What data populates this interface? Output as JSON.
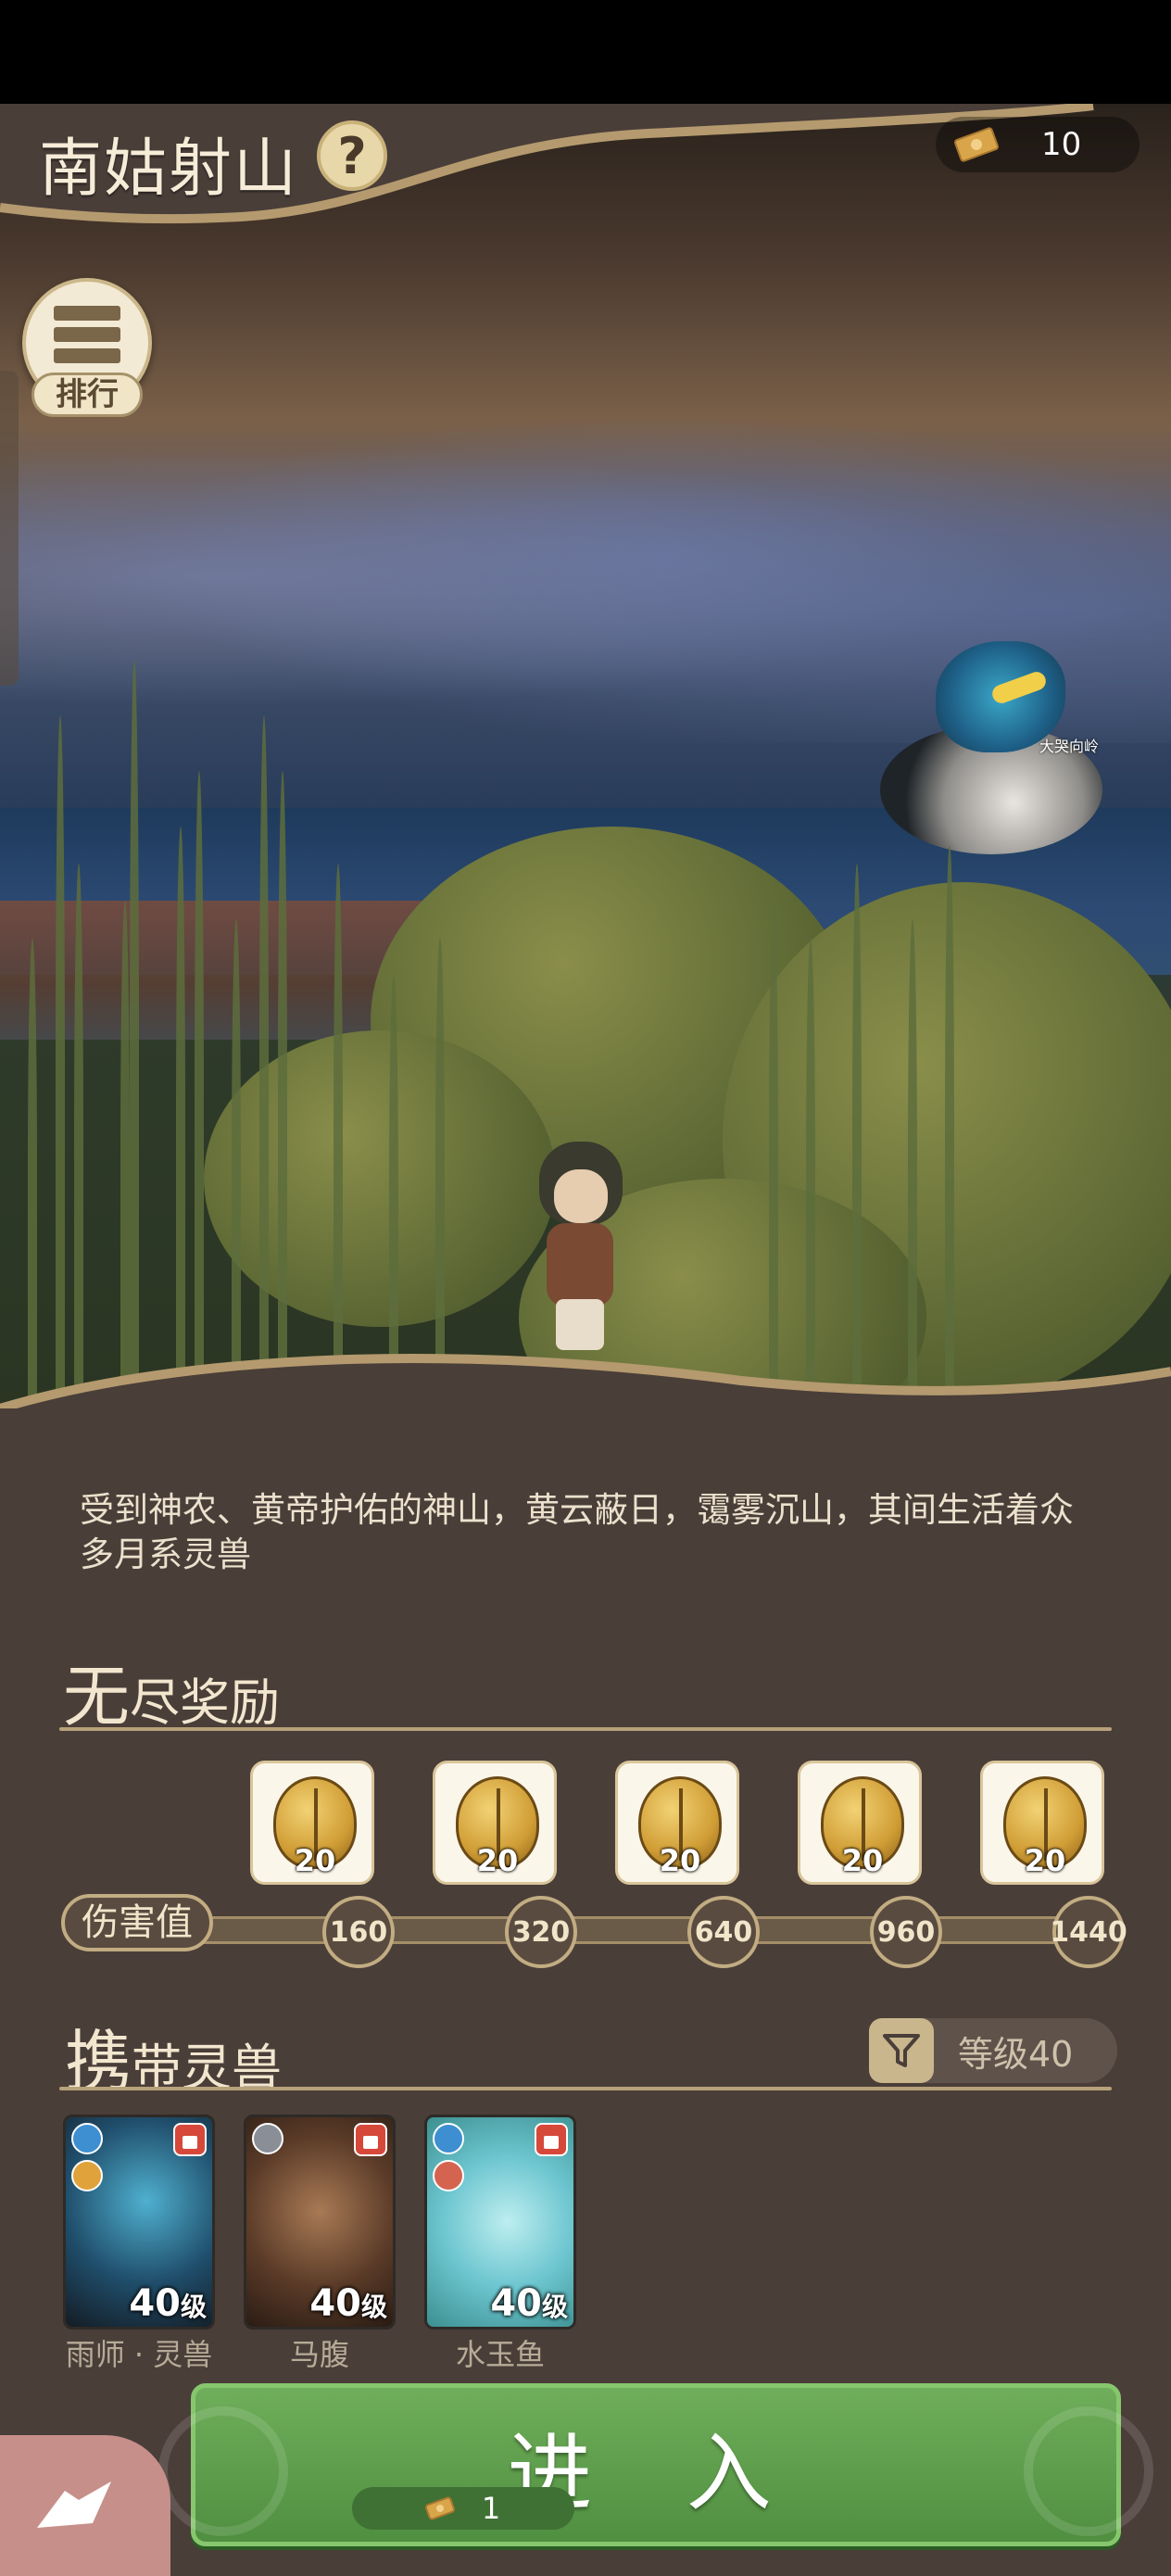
{
  "header": {
    "title": "南姑射山",
    "help_icon": "question-mark-icon",
    "ticket_count": "10"
  },
  "rank": {
    "label": "排行",
    "icon": "list-icon"
  },
  "scene": {
    "beast_nameplate": "大哭向岭"
  },
  "description": "受到神农、黄帝护佑的神山，黄云蔽日，霭雾沉山，其间生活着众多月系灵兽",
  "rewards_section": {
    "title_big": "无",
    "title_rest": "尽奖励",
    "rewards": [
      {
        "qty": "20"
      },
      {
        "qty": "20"
      },
      {
        "qty": "20"
      },
      {
        "qty": "20"
      },
      {
        "qty": "20"
      }
    ],
    "damage_label": "伤害值",
    "milestones": [
      "160",
      "320",
      "640",
      "960",
      "1440"
    ]
  },
  "beasts_section": {
    "title_big": "携",
    "title_rest": "带灵兽",
    "filter_label": "等级40",
    "cards": [
      {
        "name": "雨师 · 灵兽",
        "level": "40",
        "level_unit": "级"
      },
      {
        "name": "马腹",
        "level": "40",
        "level_unit": "级"
      },
      {
        "name": "水玉鱼",
        "level": "40",
        "level_unit": "级"
      }
    ]
  },
  "enter_button": {
    "label": "进 入",
    "cost": "1"
  },
  "colors": {
    "panel": "#4a3e39",
    "accent_gold": "#c2ac82",
    "enter_green": "#5fa24d",
    "text_light": "#ece1cd"
  }
}
